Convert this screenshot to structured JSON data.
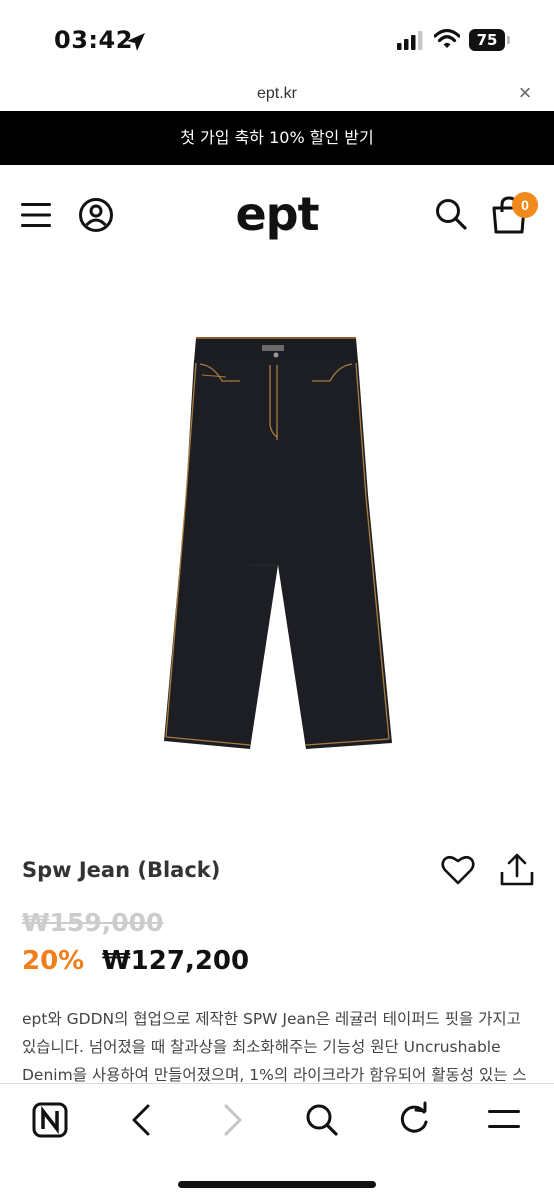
{
  "status_bar": {
    "time": "03:42",
    "battery": "75",
    "icons": [
      "location-arrow-icon",
      "cellular-signal-icon",
      "wifi-icon",
      "battery-icon"
    ]
  },
  "browser": {
    "url": "ept.kr",
    "close_symbol": "×"
  },
  "promo_banner": {
    "text": "첫 가입 축하 10% 할인 받기"
  },
  "header": {
    "logo": "ept",
    "cart_count": "0",
    "icons": [
      "menu-icon",
      "user-icon",
      "search-icon",
      "cart-icon"
    ]
  },
  "product": {
    "title": "Spw Jean (Black)",
    "original_price": "₩159,000",
    "discount": "20%",
    "sale_price": "₩127,200",
    "description_lines": [
      "ept와 GDDN의 협업으로 제작한 SPW Jean은 레귤러 테이퍼드 핏을 가지고",
      "있습니다. 넘어졌을 때 찰과상을 최소화해주는 기능성 원단 Uncrushable",
      "Denim을 사용하여 만들어졌으며, 1%의 라이크라가 함유되어 활동성 있는 스"
    ]
  },
  "toolbar": {
    "icons": [
      "naver-icon",
      "back-icon",
      "forward-icon",
      "search-icon",
      "reload-icon",
      "menu-icon"
    ]
  },
  "colors": {
    "accent_orange": "#f07f1a",
    "badge_orange": "#f2891c",
    "banner_bg": "#000000"
  }
}
